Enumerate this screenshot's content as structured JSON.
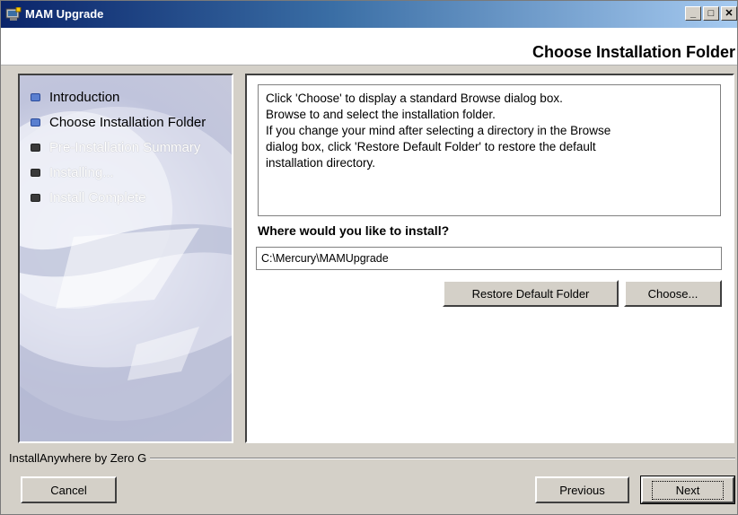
{
  "window": {
    "title": "MAM Upgrade",
    "controls": [
      "_",
      "□",
      "✕"
    ]
  },
  "header": {
    "title": "Choose Installation Folder"
  },
  "steps": [
    {
      "label": "Introduction",
      "state": "done"
    },
    {
      "label": "Choose Installation Folder",
      "state": "done"
    },
    {
      "label": "Pre-Installation Summary",
      "state": "todo"
    },
    {
      "label": "Installing...",
      "state": "todo"
    },
    {
      "label": "Install Complete",
      "state": "todo"
    }
  ],
  "content": {
    "info_lines": [
      "Click 'Choose' to display a standard Browse dialog box.",
      "Browse to and select the installation folder.",
      "If you change your mind after selecting a directory in the Browse",
      "dialog box, click 'Restore Default Folder' to restore the default",
      "installation directory."
    ],
    "question": "Where would you like to install?",
    "install_path": "C:\\Mercury\\MAMUpgrade",
    "restore_label": "Restore Default Folder",
    "choose_label": "Choose..."
  },
  "footer": {
    "brand": "InstallAnywhere by Zero G",
    "cancel_label": "Cancel",
    "previous_label": "Previous",
    "next_label": "Next"
  }
}
